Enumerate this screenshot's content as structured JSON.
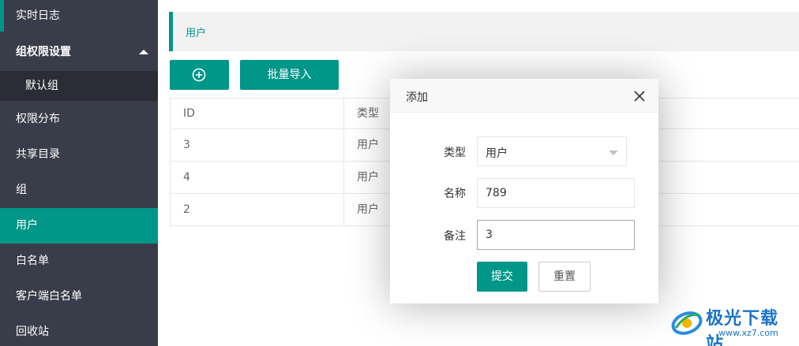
{
  "sidebar": {
    "items": [
      {
        "label": "实时日志"
      },
      {
        "label": "组权限设置"
      },
      {
        "label": "默认组"
      },
      {
        "label": "权限分布"
      },
      {
        "label": "共享目录"
      },
      {
        "label": "组"
      },
      {
        "label": "用户"
      },
      {
        "label": "白名单"
      },
      {
        "label": "客户端白名单"
      },
      {
        "label": "回收站"
      }
    ],
    "active": "用户"
  },
  "breadcrumb": {
    "label": "用户"
  },
  "toolbar": {
    "add_icon": "plus-circle-icon",
    "import_label": "批量导入"
  },
  "table": {
    "columns": [
      "ID",
      "类型"
    ],
    "rows": [
      [
        "3",
        "用户"
      ],
      [
        "4",
        "用户"
      ],
      [
        "2",
        "用户"
      ]
    ]
  },
  "modal": {
    "title": "添加",
    "close_icon": "close-icon",
    "type_label": "类型",
    "type_value": "用户",
    "name_label": "名称",
    "name_value": "789",
    "note_label": "备注",
    "note_value": "3",
    "submit_label": "提交",
    "reset_label": "重置"
  },
  "watermark": {
    "text": "极光下载站",
    "url": "www.xz7.com"
  },
  "colors": {
    "accent": "#009688",
    "sidebar_bg": "#393d49",
    "sidebar_sub_bg": "#2a2d36"
  }
}
